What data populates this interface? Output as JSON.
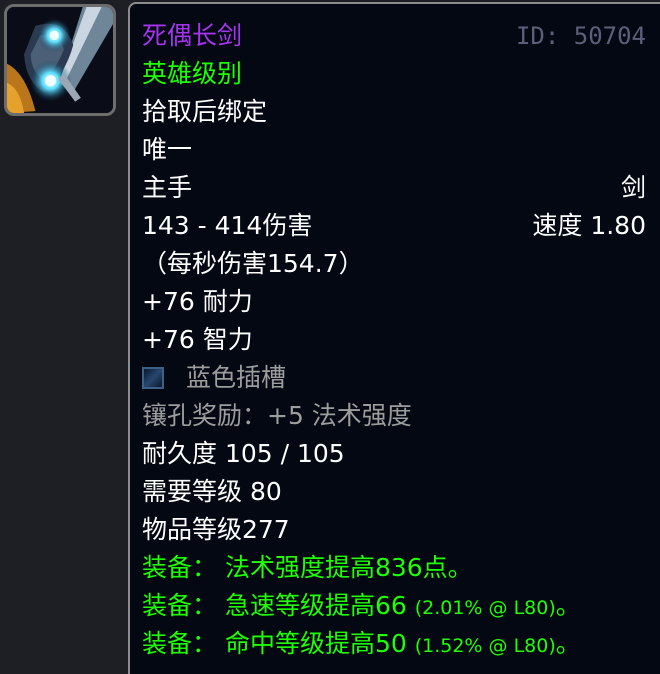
{
  "item": {
    "name": "死偶长剑",
    "id_text": "ID: 50704",
    "quality": "英雄级别",
    "binding": "拾取后绑定",
    "unique": "唯一",
    "slot": "主手",
    "type": "剑",
    "damage": "143 - 414伤害",
    "speed": "速度 1.80",
    "dps": "（每秒伤害154.7）",
    "stat_stamina": "+76 耐力",
    "stat_intellect": "+76 智力",
    "socket_label": "蓝色插槽",
    "socket_bonus": "镶孔奖励：+5 法术强度",
    "durability": "耐久度 105 / 105",
    "required_level": "需要等级 80",
    "item_level": "物品等级277",
    "equip_1": "装备： 法术强度提高836点。",
    "equip_2_main": "装备： 急速等级提高66 ",
    "equip_2_detail": "(2.01% @ L80)",
    "equip_2_end": "。",
    "equip_3_main": "装备： 命中等级提高50 ",
    "equip_3_detail": "(1.52% @ L80)",
    "equip_3_end": "。"
  },
  "colors": {
    "epic": "#a335ee",
    "green": "#1eff00",
    "white": "#ffffff",
    "grey": "#9d9d9d"
  },
  "icons": {
    "item_icon": "sword-icon",
    "socket_icon": "blue-socket-icon"
  }
}
